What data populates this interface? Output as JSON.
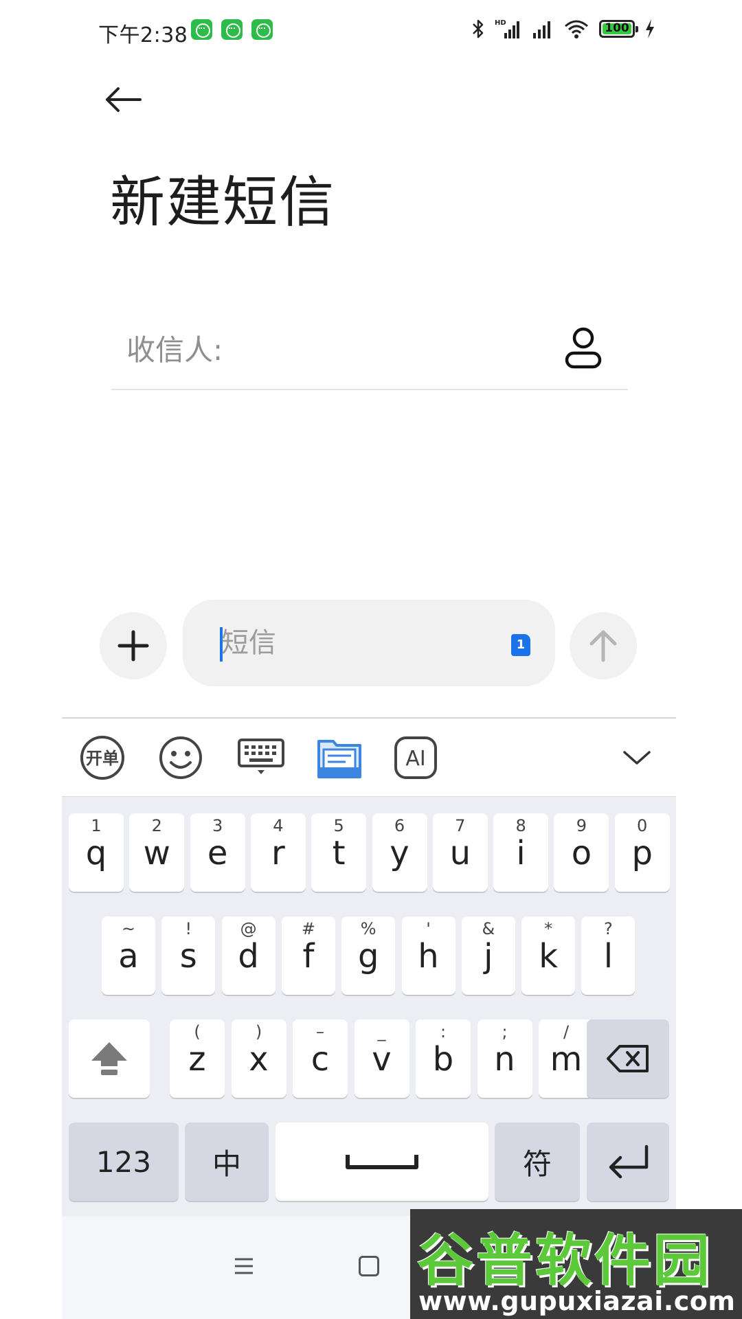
{
  "status_bar": {
    "time": "下午2:38",
    "battery_level": "100",
    "notification_count": 3
  },
  "header": {
    "title": "新建短信"
  },
  "recipient": {
    "label": "收信人:"
  },
  "compose": {
    "placeholder": "短信",
    "sim_badge": "1"
  },
  "keyboard": {
    "row1": [
      {
        "hint": "1",
        "key": "q"
      },
      {
        "hint": "2",
        "key": "w"
      },
      {
        "hint": "3",
        "key": "e"
      },
      {
        "hint": "4",
        "key": "r"
      },
      {
        "hint": "5",
        "key": "t"
      },
      {
        "hint": "6",
        "key": "y"
      },
      {
        "hint": "7",
        "key": "u"
      },
      {
        "hint": "8",
        "key": "i"
      },
      {
        "hint": "9",
        "key": "o"
      },
      {
        "hint": "0",
        "key": "p"
      }
    ],
    "row2": [
      {
        "hint": "~",
        "key": "a"
      },
      {
        "hint": "!",
        "key": "s"
      },
      {
        "hint": "@",
        "key": "d"
      },
      {
        "hint": "#",
        "key": "f"
      },
      {
        "hint": "%",
        "key": "g"
      },
      {
        "hint": "'",
        "key": "h"
      },
      {
        "hint": "&",
        "key": "j"
      },
      {
        "hint": "*",
        "key": "k"
      },
      {
        "hint": "?",
        "key": "l"
      }
    ],
    "row3": [
      {
        "hint": "(",
        "key": "z"
      },
      {
        "hint": ")",
        "key": "x"
      },
      {
        "hint": "–",
        "key": "c"
      },
      {
        "hint": "_",
        "key": "v"
      },
      {
        "hint": ":",
        "key": "b"
      },
      {
        "hint": ";",
        "key": "n"
      },
      {
        "hint": "/",
        "key": "m"
      }
    ],
    "numbers_label": "123",
    "chinese_label": "中",
    "symbols_label": "符",
    "toolbar_ai_label": "AI",
    "toolbar_quick_label": "开单"
  },
  "watermark": {
    "title": "谷普软件园",
    "url": "www.gupuxiazai.com"
  },
  "colors": {
    "accent": "#1a73e8",
    "key_background": "#ffffff",
    "function_key_background": "#d5d8e3",
    "keyboard_background": "#eceef4",
    "input_background": "#f1f1f1"
  }
}
